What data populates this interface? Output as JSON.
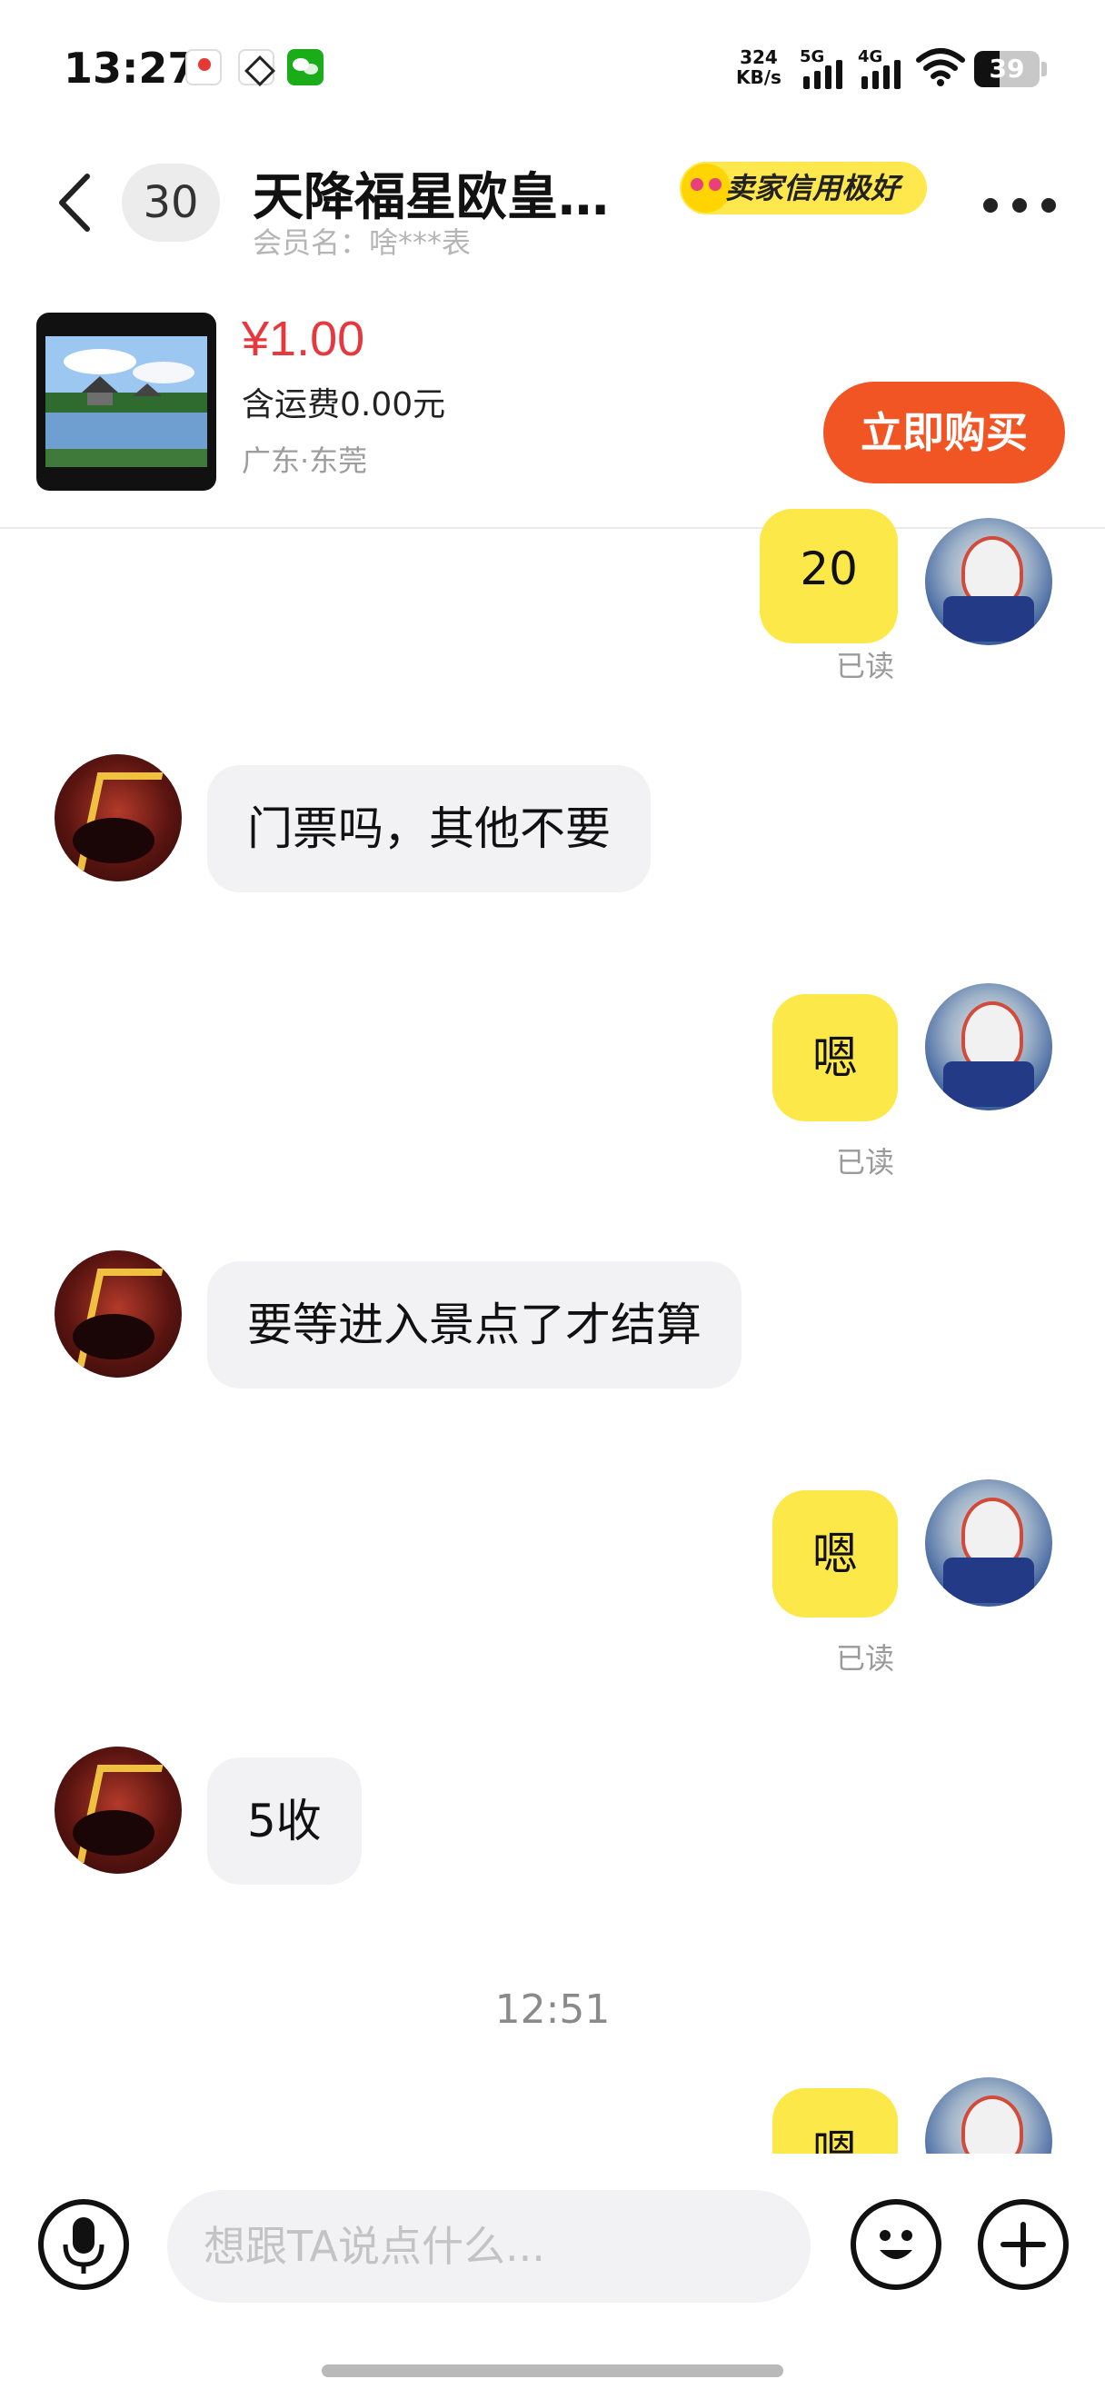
{
  "status_bar": {
    "time": "13:27",
    "net_speed_value": "324",
    "net_speed_unit": "KB/s",
    "signal_1": "5G",
    "signal_2": "4G",
    "battery": "39",
    "battery_level": 0.39,
    "notification_icons": [
      "baidu-maps-icon",
      "xianyu-icon",
      "wechat-icon"
    ]
  },
  "header": {
    "unread_count": "30",
    "title": "天降福星欧皇…",
    "member_name": "会员名：啥***表",
    "credit_badge": "卖家信用极好"
  },
  "product": {
    "price": "¥1.00",
    "shipping": "含运费0.00元",
    "location": "广东·东莞",
    "buy_label": "立即购买"
  },
  "messages": [
    {
      "from": "me",
      "text": "20",
      "status": "已读"
    },
    {
      "from": "seller",
      "text": "门票吗，其他不要"
    },
    {
      "from": "me",
      "text": "嗯",
      "status": "已读"
    },
    {
      "from": "seller",
      "text": "要等进入景点了才结算"
    },
    {
      "from": "me",
      "text": "嗯",
      "status": "已读"
    },
    {
      "from": "seller",
      "text": "5收"
    },
    {
      "timestamp": "12:51"
    },
    {
      "from": "me",
      "text": "嗯"
    }
  ],
  "composer": {
    "placeholder": "想跟TA说点什么..."
  },
  "colors": {
    "accent_yellow": "#fde84a",
    "buy_orange": "#f25524",
    "price_red": "#e5393e"
  }
}
